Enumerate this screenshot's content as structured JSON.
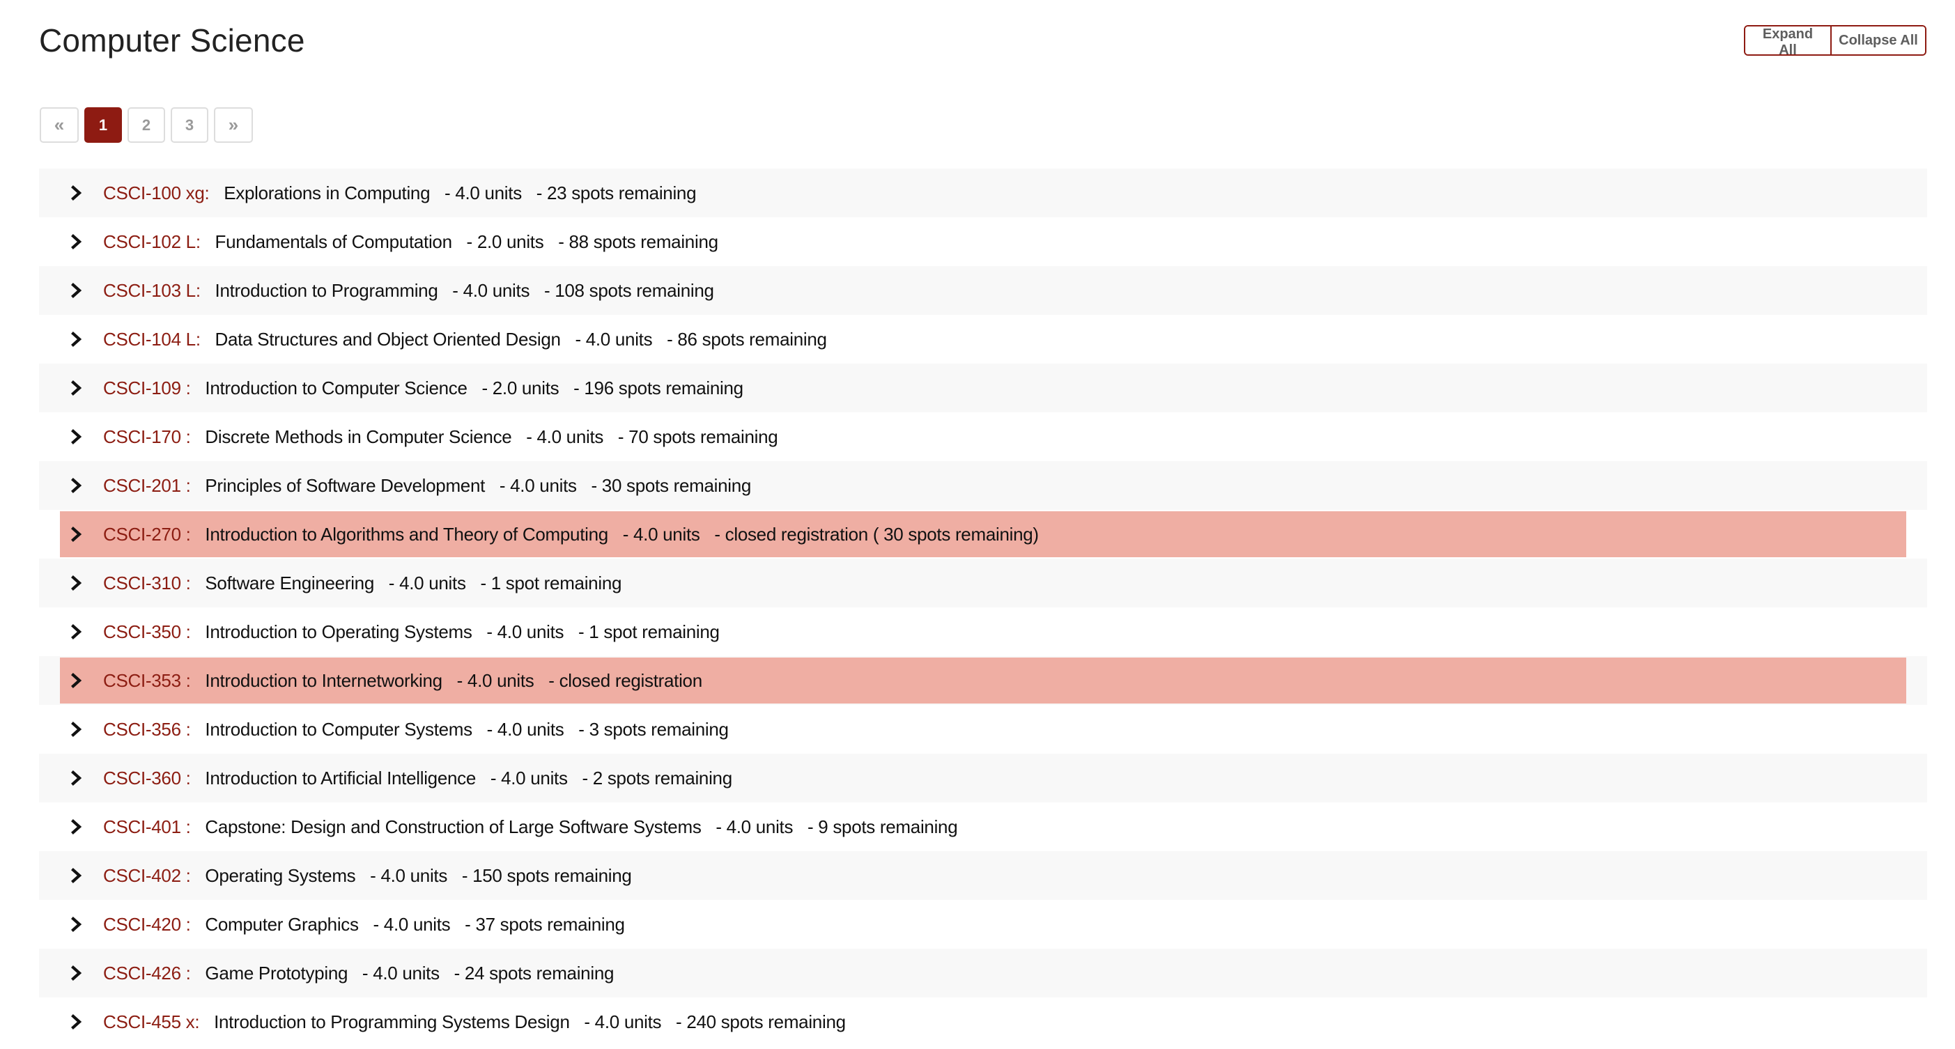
{
  "header": {
    "title": "Computer Science",
    "expand_all_label": "Expand All",
    "collapse_all_label": "Collapse All"
  },
  "pagination": {
    "prev_label": "«",
    "next_label": "»",
    "pages": [
      "1",
      "2",
      "3"
    ],
    "current_page": "1"
  },
  "colors": {
    "accent": "#8e1b12",
    "course_code": "#8c1d12",
    "closed_highlight": "#efaea3",
    "stripe": "#f8f8f8"
  },
  "courses": [
    {
      "code": "CSCI-100 xg:",
      "title": "Explorations in Computing",
      "units": "- 4.0 units",
      "status": "- 23 spots remaining",
      "closed": false
    },
    {
      "code": "CSCI-102 L:",
      "title": "Fundamentals of Computation",
      "units": "- 2.0 units",
      "status": "- 88 spots remaining",
      "closed": false
    },
    {
      "code": "CSCI-103 L:",
      "title": "Introduction to Programming",
      "units": "- 4.0 units",
      "status": "- 108 spots remaining",
      "closed": false
    },
    {
      "code": "CSCI-104 L:",
      "title": "Data Structures and Object Oriented Design",
      "units": "- 4.0 units",
      "status": "- 86 spots remaining",
      "closed": false
    },
    {
      "code": "CSCI-109 :",
      "title": "Introduction to Computer Science",
      "units": "- 2.0 units",
      "status": "- 196 spots remaining",
      "closed": false
    },
    {
      "code": "CSCI-170 :",
      "title": "Discrete Methods in Computer Science",
      "units": "- 4.0 units",
      "status": "- 70 spots remaining",
      "closed": false
    },
    {
      "code": "CSCI-201 :",
      "title": "Principles of Software Development",
      "units": "- 4.0 units",
      "status": "- 30 spots remaining",
      "closed": false
    },
    {
      "code": "CSCI-270 :",
      "title": "Introduction to Algorithms and Theory of Computing",
      "units": "- 4.0 units",
      "status": "- closed registration ( 30 spots remaining)",
      "closed": true
    },
    {
      "code": "CSCI-310 :",
      "title": "Software Engineering",
      "units": "- 4.0 units",
      "status": "- 1 spot remaining",
      "closed": false
    },
    {
      "code": "CSCI-350 :",
      "title": "Introduction to Operating Systems",
      "units": "- 4.0 units",
      "status": "- 1 spot remaining",
      "closed": false
    },
    {
      "code": "CSCI-353 :",
      "title": "Introduction to Internetworking",
      "units": "- 4.0 units",
      "status": "- closed registration",
      "closed": true
    },
    {
      "code": "CSCI-356 :",
      "title": "Introduction to Computer Systems",
      "units": "- 4.0 units",
      "status": "- 3 spots remaining",
      "closed": false
    },
    {
      "code": "CSCI-360 :",
      "title": "Introduction to Artificial Intelligence",
      "units": "- 4.0 units",
      "status": "- 2 spots remaining",
      "closed": false
    },
    {
      "code": "CSCI-401 :",
      "title": "Capstone: Design and Construction of Large Software Systems",
      "units": "- 4.0 units",
      "status": "- 9 spots remaining",
      "closed": false
    },
    {
      "code": "CSCI-402 :",
      "title": "Operating Systems",
      "units": "- 4.0 units",
      "status": "- 150 spots remaining",
      "closed": false
    },
    {
      "code": "CSCI-420 :",
      "title": "Computer Graphics",
      "units": "- 4.0 units",
      "status": "- 37 spots remaining",
      "closed": false
    },
    {
      "code": "CSCI-426 :",
      "title": "Game Prototyping",
      "units": "- 4.0 units",
      "status": "- 24 spots remaining",
      "closed": false
    },
    {
      "code": "CSCI-455 x:",
      "title": "Introduction to Programming Systems Design",
      "units": "- 4.0 units",
      "status": "- 240 spots remaining",
      "closed": false
    }
  ]
}
